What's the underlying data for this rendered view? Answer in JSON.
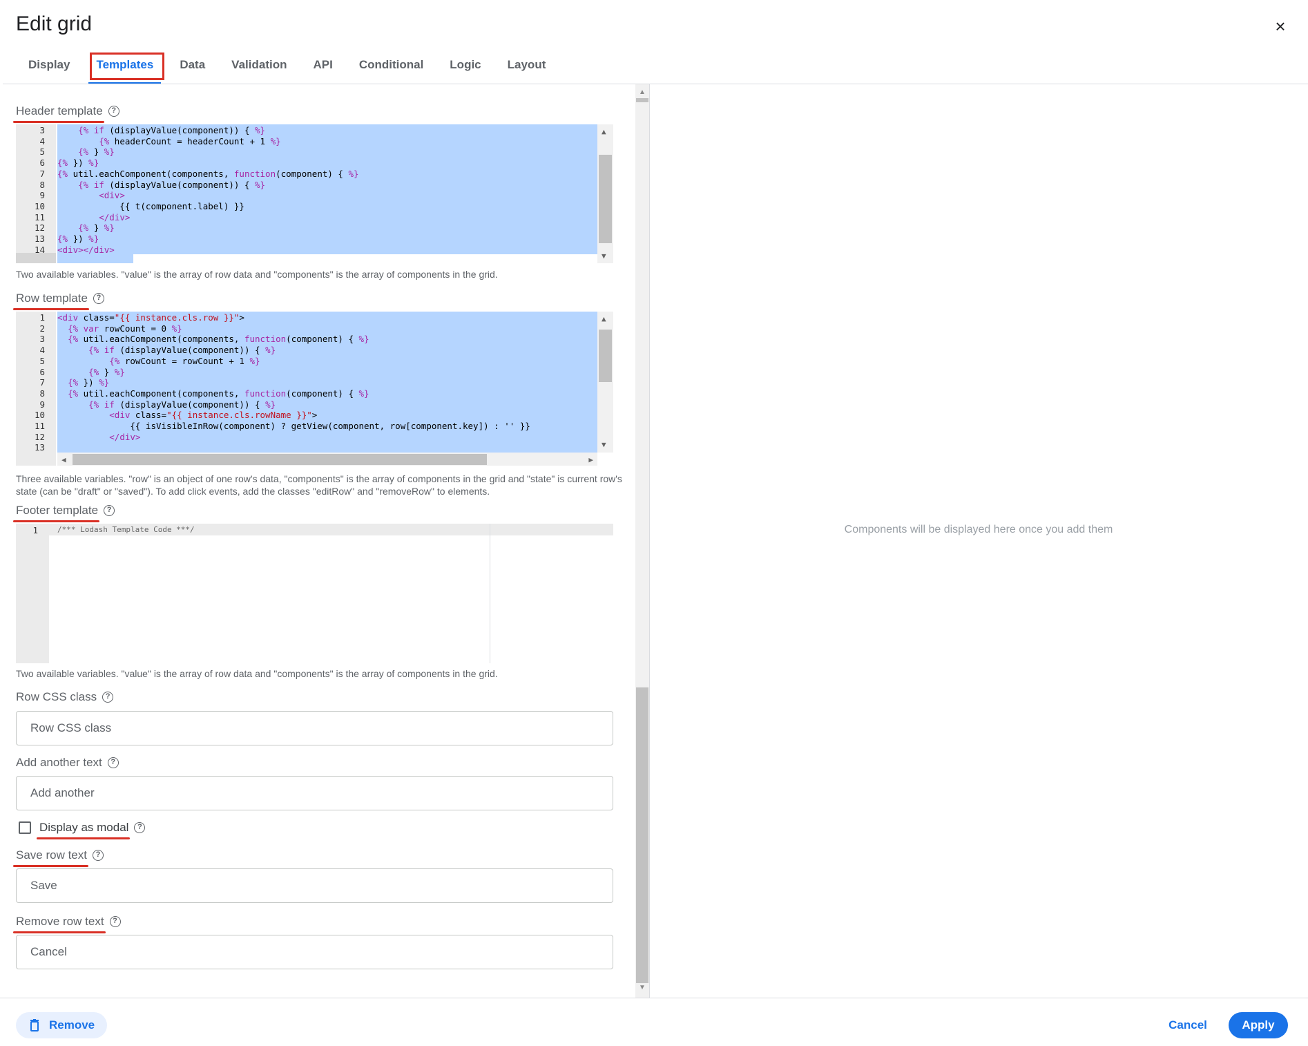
{
  "dialog": {
    "title": "Edit grid",
    "close_glyph": "×"
  },
  "tabs": [
    {
      "label": "Display"
    },
    {
      "label": "Templates"
    },
    {
      "label": "Data"
    },
    {
      "label": "Validation"
    },
    {
      "label": "API"
    },
    {
      "label": "Conditional"
    },
    {
      "label": "Logic"
    },
    {
      "label": "Layout"
    }
  ],
  "active_tab": "Templates",
  "header_template": {
    "label": "Header template",
    "description": "Two available variables. \"value\" is the array of row data and \"components\" is the array of components in the grid.",
    "lines": [
      {
        "n": "3",
        "code": "    {% if (displayValue(component)) { %}"
      },
      {
        "n": "4",
        "code": "        {% headerCount = headerCount + 1 %}"
      },
      {
        "n": "5",
        "code": "    {% } %}"
      },
      {
        "n": "6",
        "code": "{% }) %}"
      },
      {
        "n": "7",
        "code": "{% util.eachComponent(components, function(component) { %}"
      },
      {
        "n": "8",
        "code": "    {% if (displayValue(component)) { %}"
      },
      {
        "n": "9",
        "code": "        <div>"
      },
      {
        "n": "10",
        "code": "            {{ t(component.label) }}"
      },
      {
        "n": "11",
        "code": "        </div>"
      },
      {
        "n": "12",
        "code": "    {% } %}"
      },
      {
        "n": "13",
        "code": "{% }) %}"
      },
      {
        "n": "14",
        "code": "<div></div>"
      }
    ]
  },
  "row_template": {
    "label": "Row template",
    "description": "Three available variables. \"row\" is an object of one row's data, \"components\" is the array of components in the grid and \"state\" is current row's state (can be \"draft\" or \"saved\"). To add click events, add the classes \"editRow\" and \"removeRow\" to elements.",
    "lines": [
      {
        "n": "1",
        "code": "<div class=\"{{ instance.cls.row }}\">"
      },
      {
        "n": "2",
        "code": "  {% var rowCount = 0 %}"
      },
      {
        "n": "3",
        "code": "  {% util.eachComponent(components, function(component) { %}"
      },
      {
        "n": "4",
        "code": "      {% if (displayValue(component)) { %}"
      },
      {
        "n": "5",
        "code": "          {% rowCount = rowCount + 1 %}"
      },
      {
        "n": "6",
        "code": "      {% } %}"
      },
      {
        "n": "7",
        "code": "  {% }) %}"
      },
      {
        "n": "8",
        "code": "  {% util.eachComponent(components, function(component) { %}"
      },
      {
        "n": "9",
        "code": "      {% if (displayValue(component)) { %}"
      },
      {
        "n": "10",
        "code": "          <div class=\"{{ instance.cls.rowName }}\">"
      },
      {
        "n": "11",
        "code": "              {{ isVisibleInRow(component) ? getView(component, row[component.key]) : '' }}"
      },
      {
        "n": "12",
        "code": "          </div>"
      },
      {
        "n": "13",
        "code": ""
      }
    ]
  },
  "footer_template": {
    "label": "Footer template",
    "description": "Two available variables. \"value\" is the array of row data and \"components\" is the array of components in the grid.",
    "lines": [
      {
        "n": "1",
        "code": "/*** Lodash Template Code ***/"
      }
    ]
  },
  "row_css_class": {
    "label": "Row CSS class",
    "placeholder": "Row CSS class",
    "value": ""
  },
  "add_another_text": {
    "label": "Add another text",
    "placeholder": "Add another",
    "value": ""
  },
  "display_as_modal": {
    "label": "Display as modal",
    "checked": false
  },
  "save_row_text": {
    "label": "Save row text",
    "placeholder": "Save",
    "value": ""
  },
  "remove_row_text": {
    "label": "Remove row text",
    "placeholder": "Cancel",
    "value": ""
  },
  "help_glyph": "?",
  "preview": {
    "empty_message": "Components will be displayed here once you add them"
  },
  "footer": {
    "remove_label": "Remove",
    "cancel_label": "Cancel",
    "apply_label": "Apply"
  },
  "colors": {
    "accent": "#1a73e8",
    "annotation_red": "#d93025",
    "selection": "#b5d5ff"
  }
}
